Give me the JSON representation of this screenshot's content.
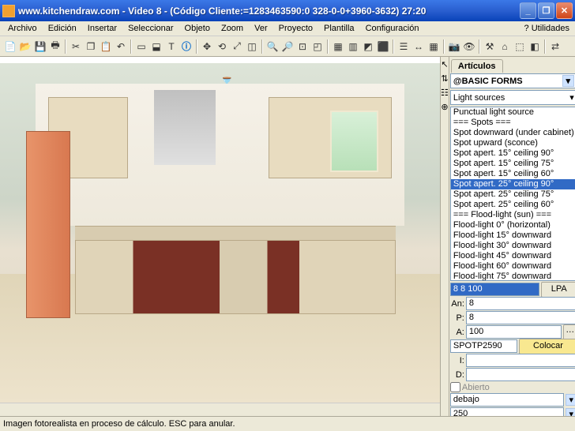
{
  "title": "www.kitchendraw.com - Video 8 - (Código Cliente:=1283463590:0 328-0-0+3960-3632) 27:20",
  "menu": {
    "archivo": "Archivo",
    "edicion": "Edición",
    "insertar": "Insertar",
    "seleccionar": "Seleccionar",
    "objeto": "Objeto",
    "zoom": "Zoom",
    "ver": "Ver",
    "proyecto": "Proyecto",
    "plantilla": "Plantilla",
    "configuracion": "Configuración",
    "utilidades": "? Utilidades"
  },
  "sidebar": {
    "tab": "Artículos",
    "catalog": "@BASIC FORMS",
    "category": "Light sources",
    "items": [
      "Punctual light source",
      "=== Spots ===",
      "Spot downward (under cabinet)",
      "Spot upward (sconce)",
      "Spot apert. 15° ceiling 90°",
      "Spot apert. 15° ceiling 75°",
      "Spot apert. 15° ceiling 60°",
      "Spot apert. 25° ceiling 90°",
      "Spot apert. 25° ceiling 75°",
      "Spot apert. 25° ceiling 60°",
      "=== Flood-light (sun) ===",
      "Flood-light 0° (horizontal)",
      "Flood-light 15° downward",
      "Flood-light 30° downward",
      "Flood-light 45° downward",
      "Flood-light 60° downward",
      "Flood-light 75° downward"
    ],
    "selected_index": 7,
    "dims": "8   8 100",
    "lpa": "LPA",
    "an": "8",
    "p": "8",
    "a": "100",
    "ref": "SPOTP2590",
    "colocar": "Colocar",
    "i_label": "I:",
    "d_label": "D:",
    "abierto": "Abierto",
    "debajo_val": "debajo",
    "debajo_num": "250",
    "an_label": "An:",
    "p_label": "P:",
    "a_label": "A:"
  },
  "status": "Imagen fotorealista en proceso de cálculo. ESC para anular.",
  "winbtns": {
    "min": "_",
    "max": "❐",
    "close": "✕"
  }
}
